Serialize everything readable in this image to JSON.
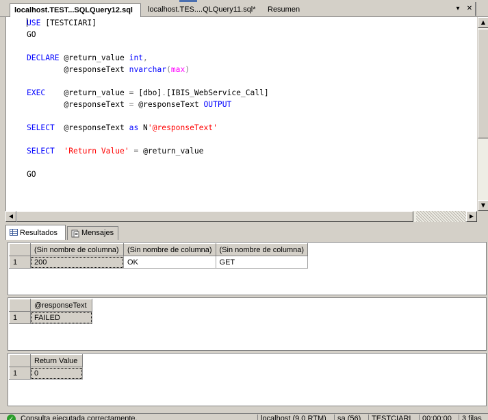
{
  "tabs": [
    {
      "label": "localhost.TEST...SQLQuery12.sql"
    },
    {
      "label": "localhost.TES....QLQuery11.sql*"
    },
    {
      "label": "Resumen"
    }
  ],
  "tab_controls": {
    "pin": "▾",
    "close": "✕"
  },
  "editor": {
    "lines": [
      [
        {
          "t": "USE",
          "c": "kw"
        },
        {
          "t": " [TESTCIARI]"
        }
      ],
      [
        {
          "t": "GO"
        }
      ],
      [],
      [
        {
          "t": "DECLARE",
          "c": "kw"
        },
        {
          "t": " @return_value "
        },
        {
          "t": "int",
          "c": "kw"
        },
        {
          "t": ",",
          "c": "gray"
        }
      ],
      [
        {
          "t": "        @responseText "
        },
        {
          "t": "nvarchar",
          "c": "kw"
        },
        {
          "t": "(",
          "c": "gray"
        },
        {
          "t": "max",
          "c": "fn"
        },
        {
          "t": ")",
          "c": "gray"
        }
      ],
      [],
      [
        {
          "t": "EXEC",
          "c": "kw"
        },
        {
          "t": "    @return_value "
        },
        {
          "t": "=",
          "c": "gray"
        },
        {
          "t": " [dbo]"
        },
        {
          "t": ".",
          "c": "gray"
        },
        {
          "t": "[IBIS_WebService_Call]"
        }
      ],
      [
        {
          "t": "        @responseText "
        },
        {
          "t": "=",
          "c": "gray"
        },
        {
          "t": " @responseText "
        },
        {
          "t": "OUTPUT",
          "c": "kw"
        }
      ],
      [],
      [
        {
          "t": "SELECT",
          "c": "kw"
        },
        {
          "t": "  @responseText "
        },
        {
          "t": "as",
          "c": "kw"
        },
        {
          "t": " N"
        },
        {
          "t": "'@responseText'",
          "c": "str"
        }
      ],
      [],
      [
        {
          "t": "SELECT",
          "c": "kw"
        },
        {
          "t": "  "
        },
        {
          "t": "'Return Value'",
          "c": "str"
        },
        {
          "t": " "
        },
        {
          "t": "=",
          "c": "gray"
        },
        {
          "t": " @return_value"
        }
      ],
      [],
      [
        {
          "t": "GO"
        }
      ]
    ]
  },
  "result_tabs": [
    {
      "label": "Resultados"
    },
    {
      "label": "Mensajes"
    }
  ],
  "grid1": {
    "columns": [
      "(Sin nombre de columna)",
      "(Sin nombre de columna)",
      "(Sin nombre de columna)"
    ],
    "row_num": "1",
    "cells": [
      "200",
      "OK",
      "GET"
    ]
  },
  "grid2": {
    "columns": [
      "@responseText"
    ],
    "row_num": "1",
    "cells": [
      "FAILED"
    ]
  },
  "grid3": {
    "columns": [
      "Return Value"
    ],
    "row_num": "1",
    "cells": [
      "0"
    ]
  },
  "status": {
    "message": "Consulta ejecutada correctamente.",
    "server": "localhost (9.0 RTM)",
    "user": "sa (56)",
    "database": "TESTCIARI",
    "time": "00:00:00",
    "rows": "3 filas"
  }
}
